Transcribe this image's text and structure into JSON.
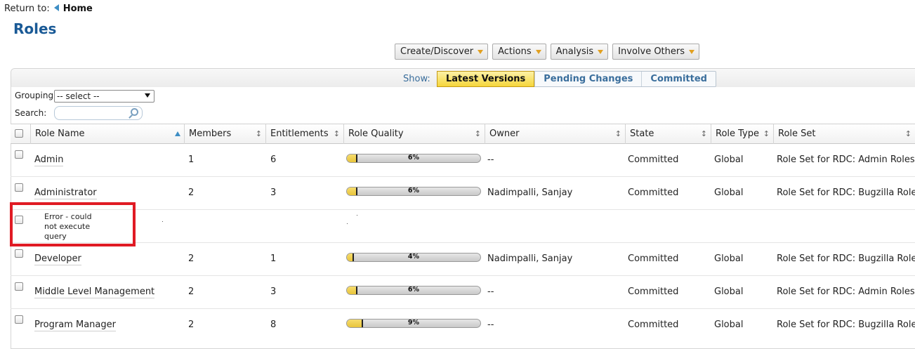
{
  "nav": {
    "return_label": "Return to:",
    "home_label": "Home"
  },
  "page": {
    "title": "Roles"
  },
  "toolbar": {
    "create_label": "Create/Discover",
    "actions_label": "Actions",
    "analysis_label": "Analysis",
    "involve_label": "Involve Others"
  },
  "show": {
    "label": "Show:",
    "options": [
      "Latest Versions",
      "Pending Changes",
      "Committed"
    ],
    "active": "Latest Versions"
  },
  "filters": {
    "grouping_label": "Grouping:",
    "grouping_value": "-- select --",
    "search_label": "Search:",
    "search_value": ""
  },
  "table": {
    "columns": [
      "Role Name",
      "Members",
      "Entitlements",
      "Role Quality",
      "Owner",
      "State",
      "Role Type",
      "Role Set"
    ],
    "sorted_column": "Role Name",
    "rows": [
      {
        "name": "Admin",
        "members": "1",
        "entitlements": "6",
        "quality": 6,
        "quality_label": "6%",
        "owner": "--",
        "state": "Committed",
        "type": "Global",
        "role_set": "Role Set for RDC: Admin Roles"
      },
      {
        "name": "Administrator",
        "members": "2",
        "entitlements": "3",
        "quality": 6,
        "quality_label": "6%",
        "owner": "Nadimpalli, Sanjay",
        "state": "Committed",
        "type": "Global",
        "role_set": "Role Set for RDC: Bugzilla Roles"
      },
      {
        "name": "Developer",
        "members": "2",
        "entitlements": "1",
        "quality": 4,
        "quality_label": "4%",
        "owner": "Nadimpalli, Sanjay",
        "state": "Committed",
        "type": "Global",
        "role_set": "Role Set for RDC: Bugzilla Roles"
      },
      {
        "name": "Middle Level Management",
        "members": "2",
        "entitlements": "3",
        "quality": 6,
        "quality_label": "6%",
        "owner": "--",
        "state": "Committed",
        "type": "Global",
        "role_set": "Role Set for RDC: Admin Roles"
      },
      {
        "name": "Program Manager",
        "members": "2",
        "entitlements": "8",
        "quality": 9,
        "quality_label": "9%",
        "owner": "--",
        "state": "Committed",
        "type": "Global",
        "role_set": "Role Set for RDC: Bugzilla Roles"
      }
    ],
    "error_row": {
      "message_lines": [
        "Error - could",
        "not execute",
        "query"
      ]
    }
  },
  "colors": {
    "title": "#1a5a96",
    "link": "#3a6e9c",
    "highlight_box": "#e01b24",
    "active_tab": "#f5d63b",
    "quality_fill": "#e9c53a",
    "menu_caret": "#e1a020"
  }
}
